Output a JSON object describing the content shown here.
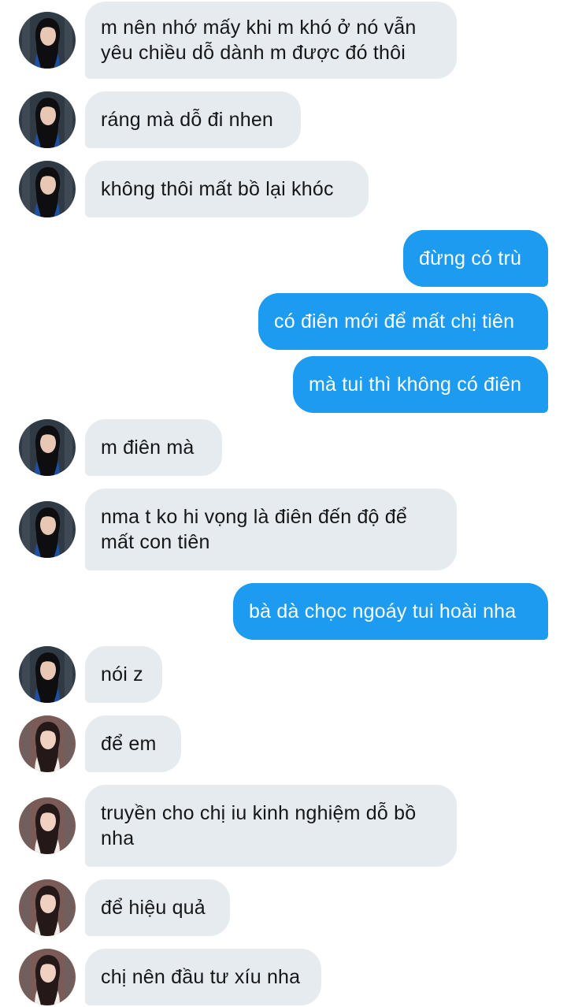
{
  "conversation": {
    "messages": [
      {
        "side": "in",
        "avatar": "a",
        "text": "m nên nhớ mấy khi m khó ở nó vẫn\nyêu chiều dỗ dành m được đó thôi"
      },
      {
        "side": "in",
        "avatar": "a",
        "text": "ráng mà dỗ đi nhen"
      },
      {
        "side": "in",
        "avatar": "a",
        "text": "không thôi mất bồ lại khóc"
      },
      {
        "side": "out",
        "text": "đừng có trù"
      },
      {
        "side": "out",
        "text": "có điên mới để mất chị tiên"
      },
      {
        "side": "out",
        "text": "mà tui thì không có điên"
      },
      {
        "side": "in",
        "avatar": "a",
        "text": "m điên mà"
      },
      {
        "side": "in",
        "avatar": "a",
        "text": "nma t ko hi vọng là điên đến độ để\nmất con tiên"
      },
      {
        "side": "out",
        "text": "bà dà chọc ngoáy tui hoài nha"
      },
      {
        "side": "in",
        "avatar": "a",
        "text": "nói z"
      },
      {
        "side": "in",
        "avatar": "b",
        "text": "để em"
      },
      {
        "side": "in",
        "avatar": "b",
        "text": "truyền cho chị iu kinh nghiệm dỗ bồ\nnha"
      },
      {
        "side": "in",
        "avatar": "b",
        "text": "để hiệu quả"
      },
      {
        "side": "in",
        "avatar": "b",
        "text": "chị nên đầu tư xíu nha"
      }
    ]
  },
  "avatars": {
    "a": {
      "icon": "avatar-dark-hair-girl",
      "bg": "#2f3a44",
      "hair": "#0e0e10",
      "skin": "#e8c7b5",
      "cloth": "#1f4fa0"
    },
    "b": {
      "icon": "avatar-white-sweater-girl",
      "bg": "#7a5b57",
      "hair": "#241918",
      "skin": "#f0d0c0",
      "cloth": "#f1eeea"
    }
  },
  "colors": {
    "incoming_bubble": "#e6ebef",
    "outgoing_bubble": "#1d9bf0",
    "incoming_text": "#14171a",
    "outgoing_text": "#ffffff"
  }
}
